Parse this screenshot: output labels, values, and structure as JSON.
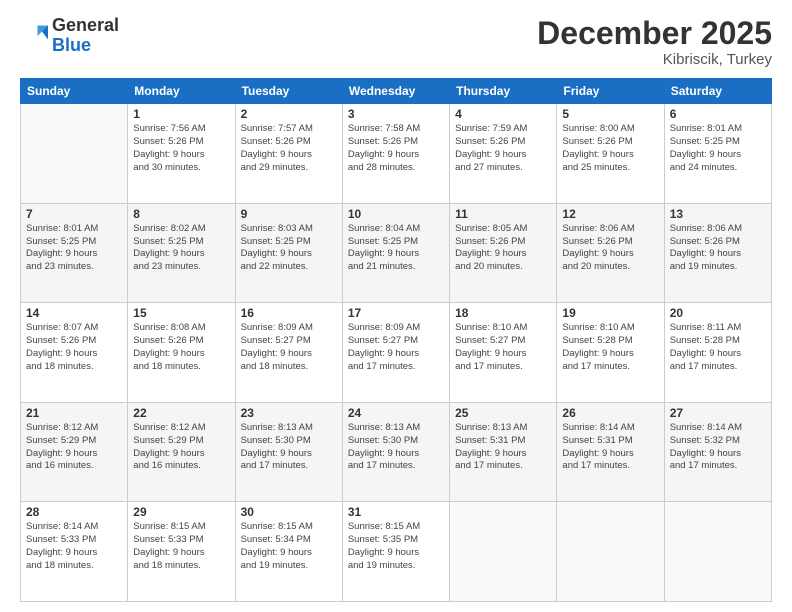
{
  "header": {
    "logo_general": "General",
    "logo_blue": "Blue",
    "month": "December 2025",
    "location": "Kibriscik, Turkey"
  },
  "days_of_week": [
    "Sunday",
    "Monday",
    "Tuesday",
    "Wednesday",
    "Thursday",
    "Friday",
    "Saturday"
  ],
  "weeks": [
    [
      {
        "day": "",
        "info": ""
      },
      {
        "day": "1",
        "info": "Sunrise: 7:56 AM\nSunset: 5:26 PM\nDaylight: 9 hours\nand 30 minutes."
      },
      {
        "day": "2",
        "info": "Sunrise: 7:57 AM\nSunset: 5:26 PM\nDaylight: 9 hours\nand 29 minutes."
      },
      {
        "day": "3",
        "info": "Sunrise: 7:58 AM\nSunset: 5:26 PM\nDaylight: 9 hours\nand 28 minutes."
      },
      {
        "day": "4",
        "info": "Sunrise: 7:59 AM\nSunset: 5:26 PM\nDaylight: 9 hours\nand 27 minutes."
      },
      {
        "day": "5",
        "info": "Sunrise: 8:00 AM\nSunset: 5:26 PM\nDaylight: 9 hours\nand 25 minutes."
      },
      {
        "day": "6",
        "info": "Sunrise: 8:01 AM\nSunset: 5:25 PM\nDaylight: 9 hours\nand 24 minutes."
      }
    ],
    [
      {
        "day": "7",
        "info": "Sunrise: 8:01 AM\nSunset: 5:25 PM\nDaylight: 9 hours\nand 23 minutes."
      },
      {
        "day": "8",
        "info": "Sunrise: 8:02 AM\nSunset: 5:25 PM\nDaylight: 9 hours\nand 23 minutes."
      },
      {
        "day": "9",
        "info": "Sunrise: 8:03 AM\nSunset: 5:25 PM\nDaylight: 9 hours\nand 22 minutes."
      },
      {
        "day": "10",
        "info": "Sunrise: 8:04 AM\nSunset: 5:25 PM\nDaylight: 9 hours\nand 21 minutes."
      },
      {
        "day": "11",
        "info": "Sunrise: 8:05 AM\nSunset: 5:26 PM\nDaylight: 9 hours\nand 20 minutes."
      },
      {
        "day": "12",
        "info": "Sunrise: 8:06 AM\nSunset: 5:26 PM\nDaylight: 9 hours\nand 20 minutes."
      },
      {
        "day": "13",
        "info": "Sunrise: 8:06 AM\nSunset: 5:26 PM\nDaylight: 9 hours\nand 19 minutes."
      }
    ],
    [
      {
        "day": "14",
        "info": "Sunrise: 8:07 AM\nSunset: 5:26 PM\nDaylight: 9 hours\nand 18 minutes."
      },
      {
        "day": "15",
        "info": "Sunrise: 8:08 AM\nSunset: 5:26 PM\nDaylight: 9 hours\nand 18 minutes."
      },
      {
        "day": "16",
        "info": "Sunrise: 8:09 AM\nSunset: 5:27 PM\nDaylight: 9 hours\nand 18 minutes."
      },
      {
        "day": "17",
        "info": "Sunrise: 8:09 AM\nSunset: 5:27 PM\nDaylight: 9 hours\nand 17 minutes."
      },
      {
        "day": "18",
        "info": "Sunrise: 8:10 AM\nSunset: 5:27 PM\nDaylight: 9 hours\nand 17 minutes."
      },
      {
        "day": "19",
        "info": "Sunrise: 8:10 AM\nSunset: 5:28 PM\nDaylight: 9 hours\nand 17 minutes."
      },
      {
        "day": "20",
        "info": "Sunrise: 8:11 AM\nSunset: 5:28 PM\nDaylight: 9 hours\nand 17 minutes."
      }
    ],
    [
      {
        "day": "21",
        "info": "Sunrise: 8:12 AM\nSunset: 5:29 PM\nDaylight: 9 hours\nand 16 minutes."
      },
      {
        "day": "22",
        "info": "Sunrise: 8:12 AM\nSunset: 5:29 PM\nDaylight: 9 hours\nand 16 minutes."
      },
      {
        "day": "23",
        "info": "Sunrise: 8:13 AM\nSunset: 5:30 PM\nDaylight: 9 hours\nand 17 minutes."
      },
      {
        "day": "24",
        "info": "Sunrise: 8:13 AM\nSunset: 5:30 PM\nDaylight: 9 hours\nand 17 minutes."
      },
      {
        "day": "25",
        "info": "Sunrise: 8:13 AM\nSunset: 5:31 PM\nDaylight: 9 hours\nand 17 minutes."
      },
      {
        "day": "26",
        "info": "Sunrise: 8:14 AM\nSunset: 5:31 PM\nDaylight: 9 hours\nand 17 minutes."
      },
      {
        "day": "27",
        "info": "Sunrise: 8:14 AM\nSunset: 5:32 PM\nDaylight: 9 hours\nand 17 minutes."
      }
    ],
    [
      {
        "day": "28",
        "info": "Sunrise: 8:14 AM\nSunset: 5:33 PM\nDaylight: 9 hours\nand 18 minutes."
      },
      {
        "day": "29",
        "info": "Sunrise: 8:15 AM\nSunset: 5:33 PM\nDaylight: 9 hours\nand 18 minutes."
      },
      {
        "day": "30",
        "info": "Sunrise: 8:15 AM\nSunset: 5:34 PM\nDaylight: 9 hours\nand 19 minutes."
      },
      {
        "day": "31",
        "info": "Sunrise: 8:15 AM\nSunset: 5:35 PM\nDaylight: 9 hours\nand 19 minutes."
      },
      {
        "day": "",
        "info": ""
      },
      {
        "day": "",
        "info": ""
      },
      {
        "day": "",
        "info": ""
      }
    ]
  ]
}
